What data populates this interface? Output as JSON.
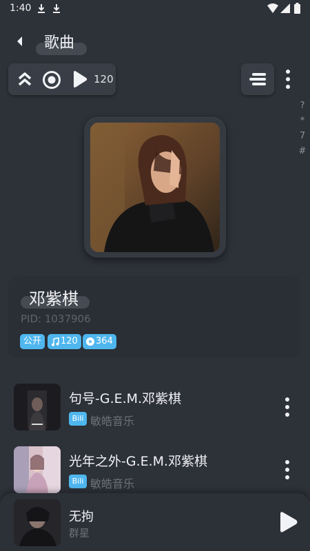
{
  "status_bar": {
    "time": "1:40"
  },
  "header": {
    "title": "歌曲"
  },
  "controls": {
    "play_count": "120"
  },
  "index_bar": [
    "?",
    "*",
    "7",
    "#"
  ],
  "artist": {
    "name": "邓紫棋",
    "pid": "PID: 1037906",
    "badges": {
      "public": "公开",
      "songs": "120",
      "plays": "364"
    }
  },
  "songs": [
    {
      "title": "句号-G.E.M.邓紫棋",
      "source": "Bili",
      "artist": "敏皓音乐"
    },
    {
      "title": "光年之外-G.E.M.邓紫棋",
      "source": "Bili",
      "artist": "敏皓音乐"
    }
  ],
  "now_playing": {
    "title": "无拘",
    "artist": "群星"
  },
  "colors": {
    "background": "#2d3138",
    "accent": "#4fb6ee",
    "card": "#393e46"
  }
}
